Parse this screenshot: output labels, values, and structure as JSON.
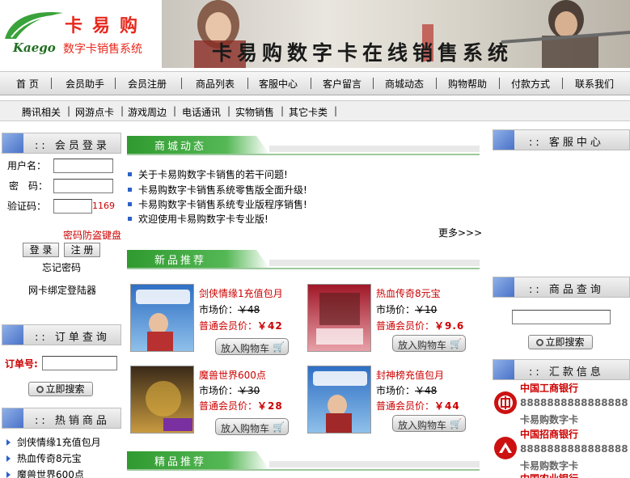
{
  "header": {
    "logo_cn": "卡易购",
    "logo_en": "Kaego",
    "logo_sub": "数字卡销售系统",
    "banner_title": "卡易购数字卡在线销售系统"
  },
  "main_nav": [
    "首 页",
    "会员助手",
    "会员注册",
    "商品列表",
    "客服中心",
    "客户留言",
    "商城动态",
    "购物帮助",
    "付款方式",
    "联系我们"
  ],
  "sub_nav": [
    "腾讯相关",
    "网游点卡",
    "游戏周边",
    "电话通讯",
    "实物销售",
    "其它卡类"
  ],
  "login": {
    "title": ":: 会员登录",
    "username_label": "用户名：",
    "password_label": "密　码：",
    "captcha_label": "验证码：",
    "captcha_value": "1169",
    "keyboard_link": "密码防盗键盘",
    "login_button": "登 录",
    "register_button": "注 册",
    "forgot_link": "忘记密码",
    "bind_link": "网卡绑定登陆器"
  },
  "order_query": {
    "title": ":: 订单查询",
    "order_label": "订单号:",
    "search_button": "立即搜索"
  },
  "hot_products": {
    "title": ":: 热销商品",
    "items": [
      "剑侠情缘1充值包月",
      "热血传奇8元宝",
      "魔兽世界600点"
    ]
  },
  "news": {
    "title": "商城动态",
    "items": [
      "关于卡易购数字卡销售的若干问题!",
      "卡易购数字卡销售系统零售版全面升级!",
      "卡易购数字卡销售系统专业版程序销售!",
      "欢迎使用卡易购数字卡专业版!"
    ],
    "more": "更多>>>"
  },
  "new_products": {
    "title": "新品推荐",
    "market_label": "市场价：",
    "member_label": "普通会员价：",
    "cart_label": "放入购物车",
    "items": [
      {
        "name": "剑侠情缘1充值包月",
        "market": "￥48",
        "member": "￥42"
      },
      {
        "name": "热血传奇8元宝",
        "market": "￥10",
        "member": "￥9.6"
      },
      {
        "name": "魔兽世界600点",
        "market": "￥30",
        "member": "￥28"
      },
      {
        "name": "封神榜充值包月",
        "market": "￥48",
        "member": "￥44"
      }
    ]
  },
  "featured": {
    "title": "精品推荐"
  },
  "service_center": {
    "title": ":: 客服中心"
  },
  "product_search": {
    "title": ":: 商品查询",
    "search_button": "立即搜索"
  },
  "payment_info": {
    "title": ":: 汇款信息",
    "banks": [
      {
        "name": "中国工商银行",
        "account": "8888888888888888",
        "holder": "卡易购数字卡"
      },
      {
        "name": "中国招商银行",
        "account": "8888888888888888",
        "holder": "卡易购数字卡"
      },
      {
        "name": "中国农业银行"
      }
    ]
  },
  "colors": {
    "accent_green": "#3aa23a",
    "price_red": "#cc0000",
    "title_blue": "#4a72c8"
  }
}
